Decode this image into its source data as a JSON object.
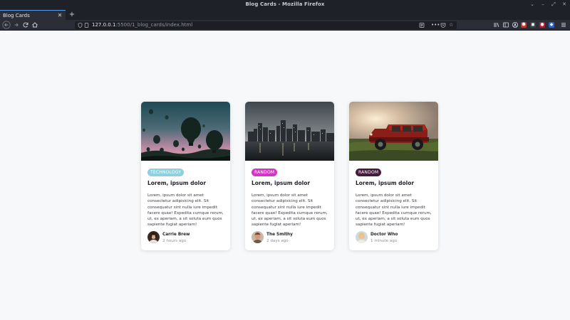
{
  "window": {
    "title": "Blog Cards - Mozilla Firefox"
  },
  "tabs": [
    {
      "label": "Blog Cards",
      "close_icon": "close-icon",
      "active": true
    }
  ],
  "toolbar": {
    "url_host": "127.0.0.1",
    "url_path": ":5500/1_blog_cards/index.html",
    "icons": [
      "back-icon",
      "forward-icon",
      "reload-icon",
      "home-icon",
      "shield-icon",
      "page-icon",
      "reader-view-icon",
      "more-icon",
      "pocket-icon",
      "bookmark-star-icon",
      "library-icon",
      "sidebar-icon",
      "account-icon",
      "extension-icon",
      "menu-icon"
    ]
  },
  "colors": {
    "page_bg": "#f7f8fa",
    "tag_technology": "#8fd0e0",
    "tag_random_pink": "#d534c4",
    "tag_random_dark": "#451b3c"
  },
  "cards": [
    {
      "image": "hot-air-balloons-at-sunset",
      "tag": "TECHNOLOGY",
      "title": "Lorem, ipsum dolor",
      "body": "Lorem, ipsum dolor sit amet consectetur adipisicing elit. Sit consequatur sint nulla iure impedit facere quae! Expedita cumque rerum, ut, ex aperiam, a sit soluta eum quos sapiente fugiat aperiam!",
      "author": "Carrie Brew",
      "time": "2 hours ago"
    },
    {
      "image": "city-skyline-at-dusk",
      "tag": "RANDOM",
      "title": "Lorem, ipsum dolor",
      "body": "Lorem, ipsum dolor sit amet consectetur adipisicing elit. Sit consequatur sint nulla iure impedit facere quae! Expedita cumque rerum, ut, ex aperiam, a sit soluta eum quos sapiente fugiat aperiam!",
      "author": "The Smithy",
      "time": "2 days ago"
    },
    {
      "image": "red-jeep-in-field",
      "tag": "RANDOM",
      "title": "Lorem, ipsum dolor",
      "body": "Lorem, ipsum dolor sit amet consectetur adipisicing elit. Sit consequatur sint nulla iure impedit facere quae! Expedita cumque rerum, ut, ex aperiam, a sit soluta eum quos sapiente fugiat aperiam!",
      "author": "Doctor Who",
      "time": "1 minute ago"
    }
  ]
}
